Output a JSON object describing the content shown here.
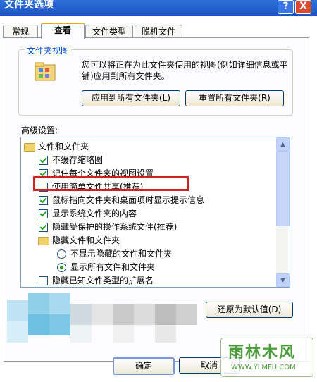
{
  "window": {
    "title": "文件夹选项",
    "help_glyph": "?",
    "close_glyph": "X"
  },
  "tabs": [
    {
      "label": "常规",
      "active": false
    },
    {
      "label": "查看",
      "active": true
    },
    {
      "label": "文件类型",
      "active": false
    },
    {
      "label": "脱机文件",
      "active": false
    }
  ],
  "folder_views": {
    "group_title": "文件夹视图",
    "description": "您可以将正在为此文件夹使用的视图(例如详细信息或平铺)应用到所有文件夹。",
    "apply_button": "应用到所有文件夹(L)",
    "reset_button": "重置所有文件夹(R)"
  },
  "advanced": {
    "label": "高级设置:",
    "items": [
      {
        "kind": "folder",
        "label": "文件和文件夹",
        "indent": 0
      },
      {
        "kind": "checkbox",
        "label": "不缓存缩略图",
        "checked": true,
        "indent": 1
      },
      {
        "kind": "checkbox",
        "label": "记住每个文件夹的视图设置",
        "checked": true,
        "indent": 1
      },
      {
        "kind": "checkbox",
        "label": "使用简单文件共享(推荐)",
        "checked": false,
        "indent": 1,
        "highlighted": true
      },
      {
        "kind": "checkbox",
        "label": "鼠标指向文件夹和桌面项时显示提示信息",
        "checked": true,
        "indent": 1
      },
      {
        "kind": "checkbox",
        "label": "显示系统文件夹的内容",
        "checked": true,
        "indent": 1
      },
      {
        "kind": "checkbox",
        "label": "隐藏受保护的操作系统文件(推荐)",
        "checked": true,
        "indent": 1
      },
      {
        "kind": "folder",
        "label": "隐藏文件和文件夹",
        "indent": 1
      },
      {
        "kind": "radio",
        "label": "不显示隐藏的文件和文件夹",
        "checked": false,
        "indent": 2
      },
      {
        "kind": "radio",
        "label": "显示所有文件和文件夹",
        "checked": true,
        "indent": 2
      },
      {
        "kind": "checkbox",
        "label": "隐藏已知文件类型的扩展名",
        "checked": false,
        "indent": 1
      }
    ],
    "restore_button": "还原为默认值(D)"
  },
  "footer": {
    "ok_button": "确定",
    "cancel_button": "取消"
  },
  "watermark": {
    "name": "雨林木风",
    "url": "WWW.YLMFU.COM"
  }
}
